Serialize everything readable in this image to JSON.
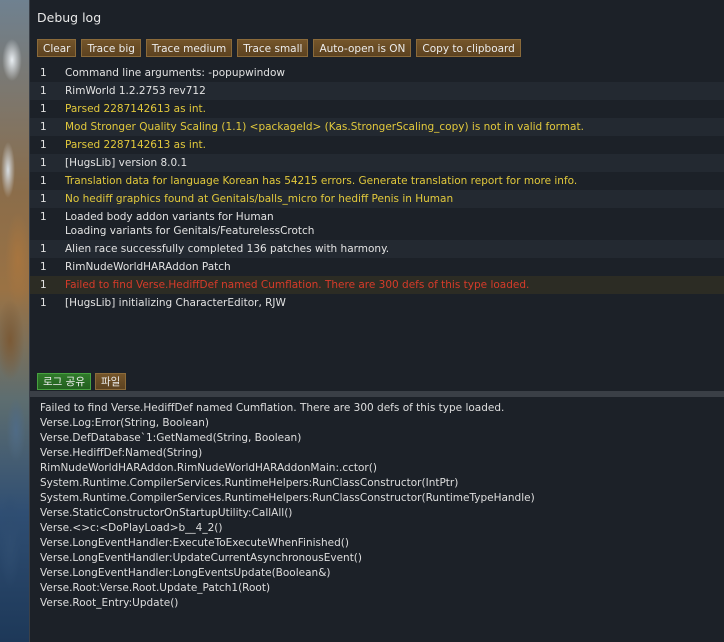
{
  "window": {
    "title": "Debug log"
  },
  "toolbar": {
    "buttons": [
      {
        "name": "clear-button",
        "label": "Clear"
      },
      {
        "name": "trace-big-button",
        "label": "Trace big"
      },
      {
        "name": "trace-medium-button",
        "label": "Trace medium"
      },
      {
        "name": "trace-small-button",
        "label": "Trace small"
      },
      {
        "name": "auto-open-button",
        "label": "Auto-open is ON"
      },
      {
        "name": "copy-to-clipboard-button",
        "label": "Copy to clipboard"
      }
    ]
  },
  "colors": {
    "warning": "#e2c93c",
    "error": "#d63b2a",
    "button_brown": "#6a4d25",
    "tab_green": "#2f7a2a"
  },
  "log": {
    "rows": [
      {
        "count": "1",
        "lines": [
          "Command line arguments: -popupwindow"
        ],
        "level": "info"
      },
      {
        "count": "1",
        "lines": [
          "RimWorld 1.2.2753 rev712"
        ],
        "level": "info"
      },
      {
        "count": "1",
        "lines": [
          "Parsed 2287142613 as int."
        ],
        "level": "warn"
      },
      {
        "count": "1",
        "lines": [
          "Mod Stronger Quality Scaling (1.1) <packageId> (Kas.StrongerScaling_copy) is not in valid format."
        ],
        "level": "warn"
      },
      {
        "count": "1",
        "lines": [
          "Parsed 2287142613 as int."
        ],
        "level": "warn"
      },
      {
        "count": "1",
        "lines": [
          "[HugsLib] version 8.0.1"
        ],
        "level": "info"
      },
      {
        "count": "1",
        "lines": [
          "Translation data for language Korean has 54215 errors. Generate translation report for more info."
        ],
        "level": "warn"
      },
      {
        "count": "1",
        "lines": [
          "No hediff graphics found at Genitals/balls_micro for hediff Penis in Human"
        ],
        "level": "warn"
      },
      {
        "count": "1",
        "lines": [
          "Loaded body addon variants for Human",
          "Loading variants for Genitals/FeaturelessCrotch"
        ],
        "level": "info"
      },
      {
        "count": "1",
        "lines": [
          "Alien race successfully completed 136 patches with harmony."
        ],
        "level": "info"
      },
      {
        "count": "1",
        "lines": [
          "RimNudeWorldHARAddon Patch"
        ],
        "level": "info"
      },
      {
        "count": "1",
        "lines": [
          "Failed to find Verse.HediffDef named Cumflation. There are 300 defs of this type loaded."
        ],
        "level": "err"
      },
      {
        "count": "1",
        "lines": [
          "[HugsLib] initializing CharacterEditor, RJW"
        ],
        "level": "info"
      }
    ]
  },
  "tabs": [
    {
      "name": "share-log-tab",
      "label": "로그 공유",
      "style": "green"
    },
    {
      "name": "file-tab",
      "label": "파일",
      "style": "brown"
    }
  ],
  "detail": {
    "lines": [
      "Failed to find Verse.HediffDef named Cumflation. There are 300 defs of this type loaded.",
      "Verse.Log:Error(String, Boolean)",
      "Verse.DefDatabase`1:GetNamed(String, Boolean)",
      "Verse.HediffDef:Named(String)",
      "RimNudeWorldHARAddon.RimNudeWorldHARAddonMain:.cctor()",
      "System.Runtime.CompilerServices.RuntimeHelpers:RunClassConstructor(IntPtr)",
      "System.Runtime.CompilerServices.RuntimeHelpers:RunClassConstructor(RuntimeTypeHandle)",
      "Verse.StaticConstructorOnStartupUtility:CallAll()",
      "Verse.<>c:<DoPlayLoad>b__4_2()",
      "Verse.LongEventHandler:ExecuteToExecuteWhenFinished()",
      "Verse.LongEventHandler:UpdateCurrentAsynchronousEvent()",
      "Verse.LongEventHandler:LongEventsUpdate(Boolean&)",
      "Verse.Root:Verse.Root.Update_Patch1(Root)",
      "Verse.Root_Entry:Update()"
    ]
  }
}
